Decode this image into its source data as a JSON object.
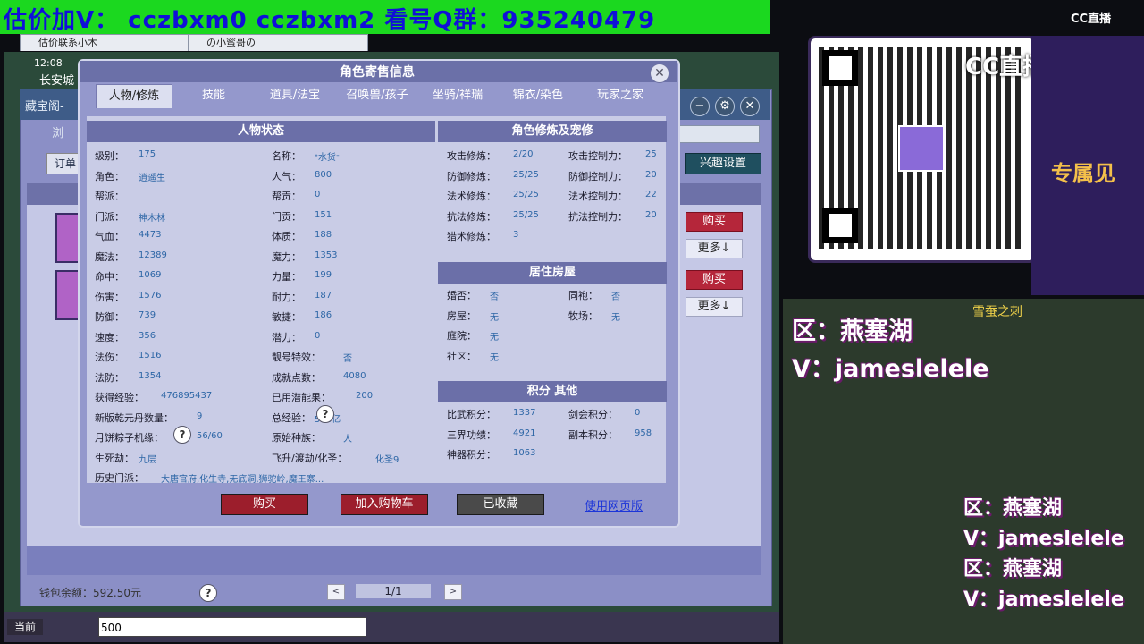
{
  "banner": "估价加V：  cczbxm0   cczbxm2   看号Q群：935240479",
  "browser_tabs": [
    "估价联系小木",
    "の小蜜哥の"
  ],
  "game": {
    "time": "12:08",
    "city": "长安城",
    "under_title": "藏宝阁-",
    "nav": "浏",
    "order": "订单",
    "interest_settings": "兴趣设置",
    "buy": "购买",
    "more": "更多↓",
    "wallet": "钱包余额：592.50元",
    "help": "?",
    "page": "1/1",
    "prev": "<",
    "next": ">",
    "chat_label": "当前",
    "chat_input": "500"
  },
  "dialog": {
    "title": "角色寄售信息",
    "tabs": [
      "人物/修炼",
      "技能",
      "道具/法宝",
      "召唤兽/孩子",
      "坐骑/祥瑞",
      "锦衣/染色",
      "玩家之家"
    ],
    "status": {
      "title": "人物状态",
      "col1": [
        [
          "级别：",
          "175"
        ],
        [
          "角色：",
          "逍遥生"
        ],
        [
          "帮派：",
          ""
        ],
        [
          "门派：",
          "神木林"
        ],
        [
          "气血：",
          "4473"
        ],
        [
          "魔法：",
          "12389"
        ],
        [
          "命中：",
          "1069"
        ],
        [
          "伤害：",
          "1576"
        ],
        [
          "防御：",
          "739"
        ],
        [
          "速度：",
          "356"
        ],
        [
          "法伤：",
          "1516"
        ],
        [
          "法防：",
          "1354"
        ],
        [
          "获得经验：",
          "476895437"
        ],
        [
          "新版乾元丹数量：",
          "9"
        ],
        [
          "月饼粽子机缘：",
          "56/60"
        ],
        [
          "生死劫：",
          "九层"
        ],
        [
          "历史门派：",
          "大唐官府,化生寺,无底洞,狮驼岭,魔王寨..."
        ]
      ],
      "col2": [
        [
          "名称：",
          "ᐩ水货ᐨ"
        ],
        [
          "人气：",
          "800"
        ],
        [
          "帮贡：",
          "0"
        ],
        [
          "门贡：",
          "151"
        ],
        [
          "体质：",
          "188"
        ],
        [
          "魔力：",
          "1353"
        ],
        [
          "力量：",
          "199"
        ],
        [
          "耐力：",
          "187"
        ],
        [
          "敏捷：",
          "186"
        ],
        [
          "潜力：",
          "0"
        ],
        [
          "靓号特效：",
          "否"
        ],
        [
          "成就点数：",
          "4080"
        ],
        [
          "已用潜能果：",
          "200"
        ],
        [
          "总经验：",
          "568亿"
        ],
        [
          "原始种族：",
          "人"
        ],
        [
          "飞升/渡劫/化圣：",
          "化圣9"
        ]
      ]
    },
    "cultivation": {
      "title": "角色修炼及宠修",
      "col1": [
        [
          "攻击修炼：",
          "2/20"
        ],
        [
          "防御修炼：",
          "25/25"
        ],
        [
          "法术修炼：",
          "25/25"
        ],
        [
          "抗法修炼：",
          "25/25"
        ],
        [
          "猎术修炼：",
          "3"
        ]
      ],
      "col2": [
        [
          "攻击控制力：",
          "25"
        ],
        [
          "防御控制力：",
          "20"
        ],
        [
          "法术控制力：",
          "22"
        ],
        [
          "抗法控制力：",
          "20"
        ]
      ]
    },
    "house": {
      "title": "居住房屋",
      "col1": [
        [
          "婚否：",
          "否"
        ],
        [
          "房屋：",
          "无"
        ],
        [
          "庭院：",
          "无"
        ],
        [
          "社区：",
          "无"
        ]
      ],
      "col2": [
        [
          "同袍：",
          "否"
        ],
        [
          "牧场：",
          "无"
        ]
      ]
    },
    "score": {
      "title": "积分 其他",
      "col1": [
        [
          "比武积分：",
          "1337"
        ],
        [
          "三界功绩：",
          "4921"
        ],
        [
          "神器积分：",
          "1063"
        ]
      ],
      "col2": [
        [
          "剑会积分：",
          "0"
        ],
        [
          "副本积分：",
          "958"
        ]
      ]
    },
    "buttons": {
      "buy": "购买",
      "cart": "加入购物车",
      "favorited": "已收藏",
      "web": "使用网页版"
    }
  },
  "stream": {
    "cc_logo": "CC直播",
    "qr_badge": "CC直播",
    "promo": "专属见",
    "area1": "区：燕塞湖",
    "v1": "V：jameslelele",
    "area2": "区：燕塞湖",
    "v2": "V：jameslelele",
    "area3": "区：燕塞湖",
    "v3": "V：jameslelele",
    "game_title": "雪蚕之刺"
  }
}
